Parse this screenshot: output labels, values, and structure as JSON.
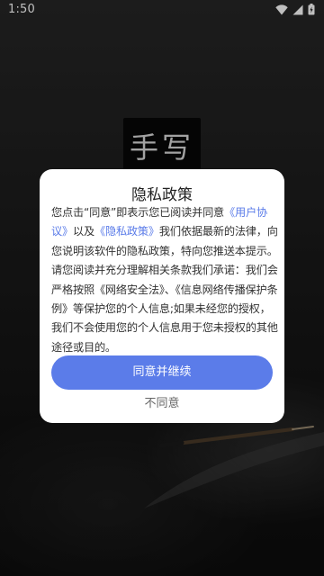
{
  "status_bar": {
    "time": "1:50",
    "icons": [
      "wifi-icon",
      "signal-icon",
      "battery-icon"
    ]
  },
  "app": {
    "logo_text": "手写"
  },
  "dialog": {
    "title": "隐私政策",
    "body_segments": [
      {
        "text": "您点击“同意”即表示您已阅读并同意",
        "link": false
      },
      {
        "text": "《用户协议》",
        "link": true
      },
      {
        "text": "以及",
        "link": false
      },
      {
        "text": "《隐私政策》",
        "link": true
      },
      {
        "text": "我们依据最新的法律，向您说明该软件的隐私政策，特向您推送本提示。请您阅读并充分理解相关条款我们承诺：我们会严格按照《网络安全法》、《信息网络传播保护条例》等保护您的个人信息;如果未经您的授权，我们不会使用您的个人信息用于您未授权的其他途径或目的。",
        "link": false
      }
    ],
    "agree_label": "同意并继续",
    "disagree_label": "不同意"
  },
  "colors": {
    "accent": "#5b7ce9",
    "background": "#141414",
    "dialog_background": "#ffffff"
  }
}
